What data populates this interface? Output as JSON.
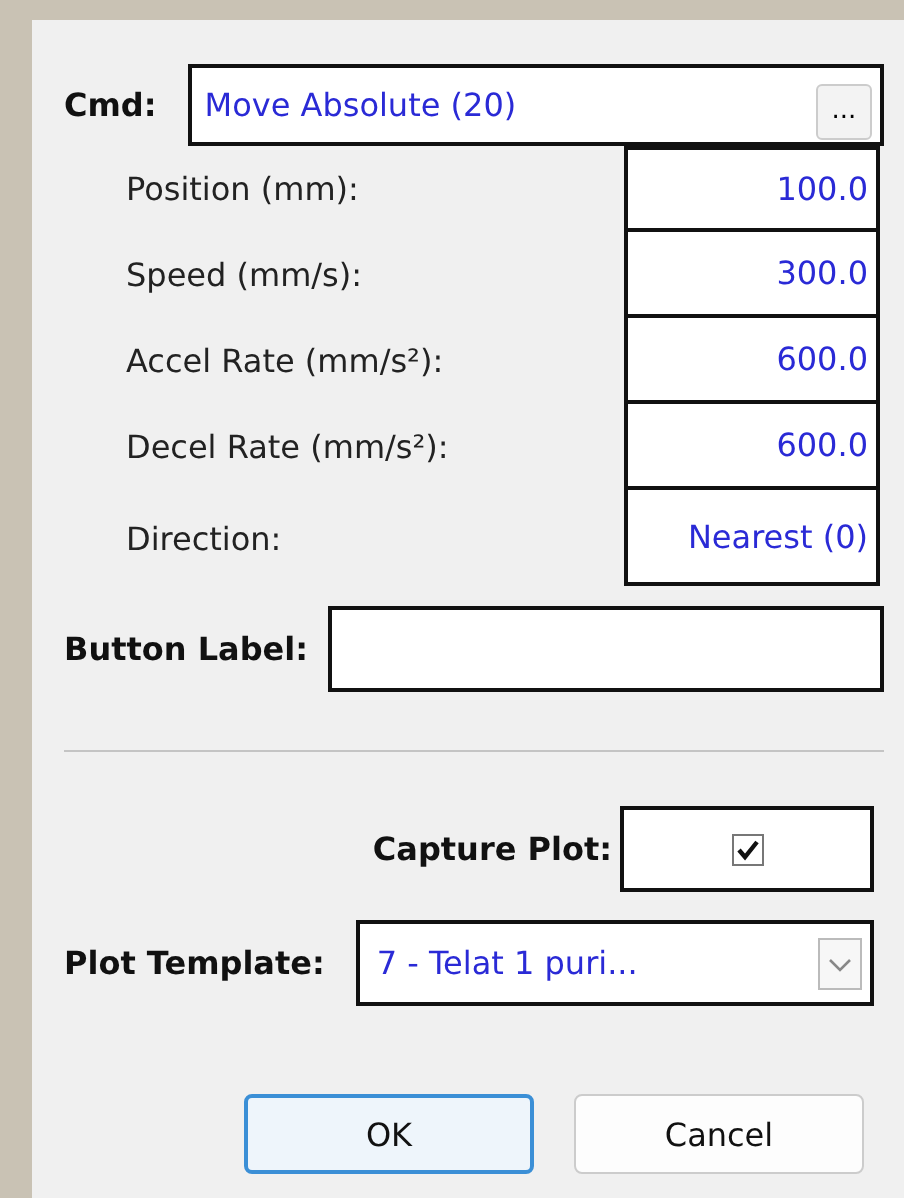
{
  "cmd": {
    "label": "Cmd:",
    "value": "Move Absolute (20)",
    "browse": "..."
  },
  "params": [
    {
      "label": "Position (mm):",
      "value": "100.0"
    },
    {
      "label": "Speed (mm/s):",
      "value": "300.0"
    },
    {
      "label": "Accel Rate (mm/s²):",
      "value": "600.0"
    },
    {
      "label": "Decel Rate (mm/s²):",
      "value": "600.0"
    },
    {
      "label": "Direction:",
      "value": "Nearest (0)"
    }
  ],
  "button_label": {
    "label": "Button Label:"
  },
  "capture_plot": {
    "label": "Capture Plot:",
    "checked": true
  },
  "plot_template": {
    "label": "Plot Template:",
    "value": "7 - Telat 1 puri..."
  },
  "buttons": [
    {
      "label": "OK",
      "default": true
    },
    {
      "label": "Cancel",
      "default": false
    }
  ]
}
